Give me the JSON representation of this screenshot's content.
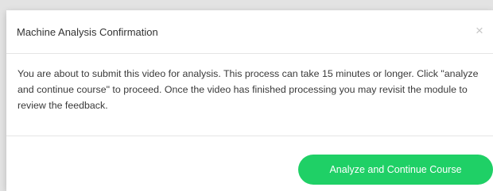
{
  "modal": {
    "title": "Machine Analysis Confirmation",
    "close_glyph": "×",
    "body_text": "You are about to submit this video for analysis. This process can take 15 minutes or longer. Click \"analyze and continue course\" to proceed. Once the video has finished processing you may revisit the module to review the feedback.",
    "primary_button_label": "Analyze and Continue Course"
  },
  "colors": {
    "primary_button": "#1fd066",
    "backdrop": "#e3e3e3"
  },
  "icons": {
    "close": "close-icon"
  }
}
